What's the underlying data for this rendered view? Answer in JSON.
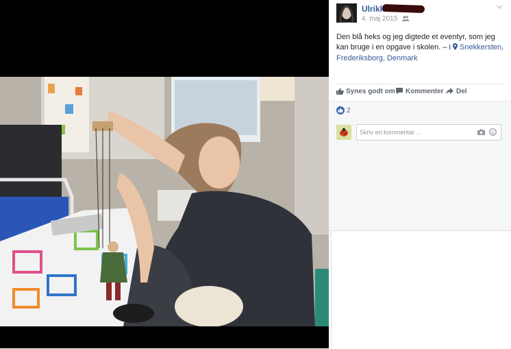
{
  "post": {
    "author": "Ulrikke",
    "date": "4. maj 2015",
    "text": "Den blå heks og jeg digtede et eventyr, som jeg kan bruge i en opgave i skolen. – i ",
    "location": "Snekkersten, Frederiksborg, Denmark"
  },
  "actions": {
    "like": "Synes godt om",
    "comment": "Kommenter",
    "share": "Del"
  },
  "reactions": {
    "count": "2"
  },
  "comment": {
    "placeholder": "Skriv en kommentar ..."
  },
  "colors": {
    "link": "#365899",
    "like_blue": "#4267b2",
    "muted": "#90949c"
  },
  "icons": [
    "audience-icon",
    "chevron-down-icon",
    "location-pin-icon",
    "like-icon",
    "comment-icon",
    "share-icon",
    "camera-icon",
    "sticker-icon"
  ]
}
